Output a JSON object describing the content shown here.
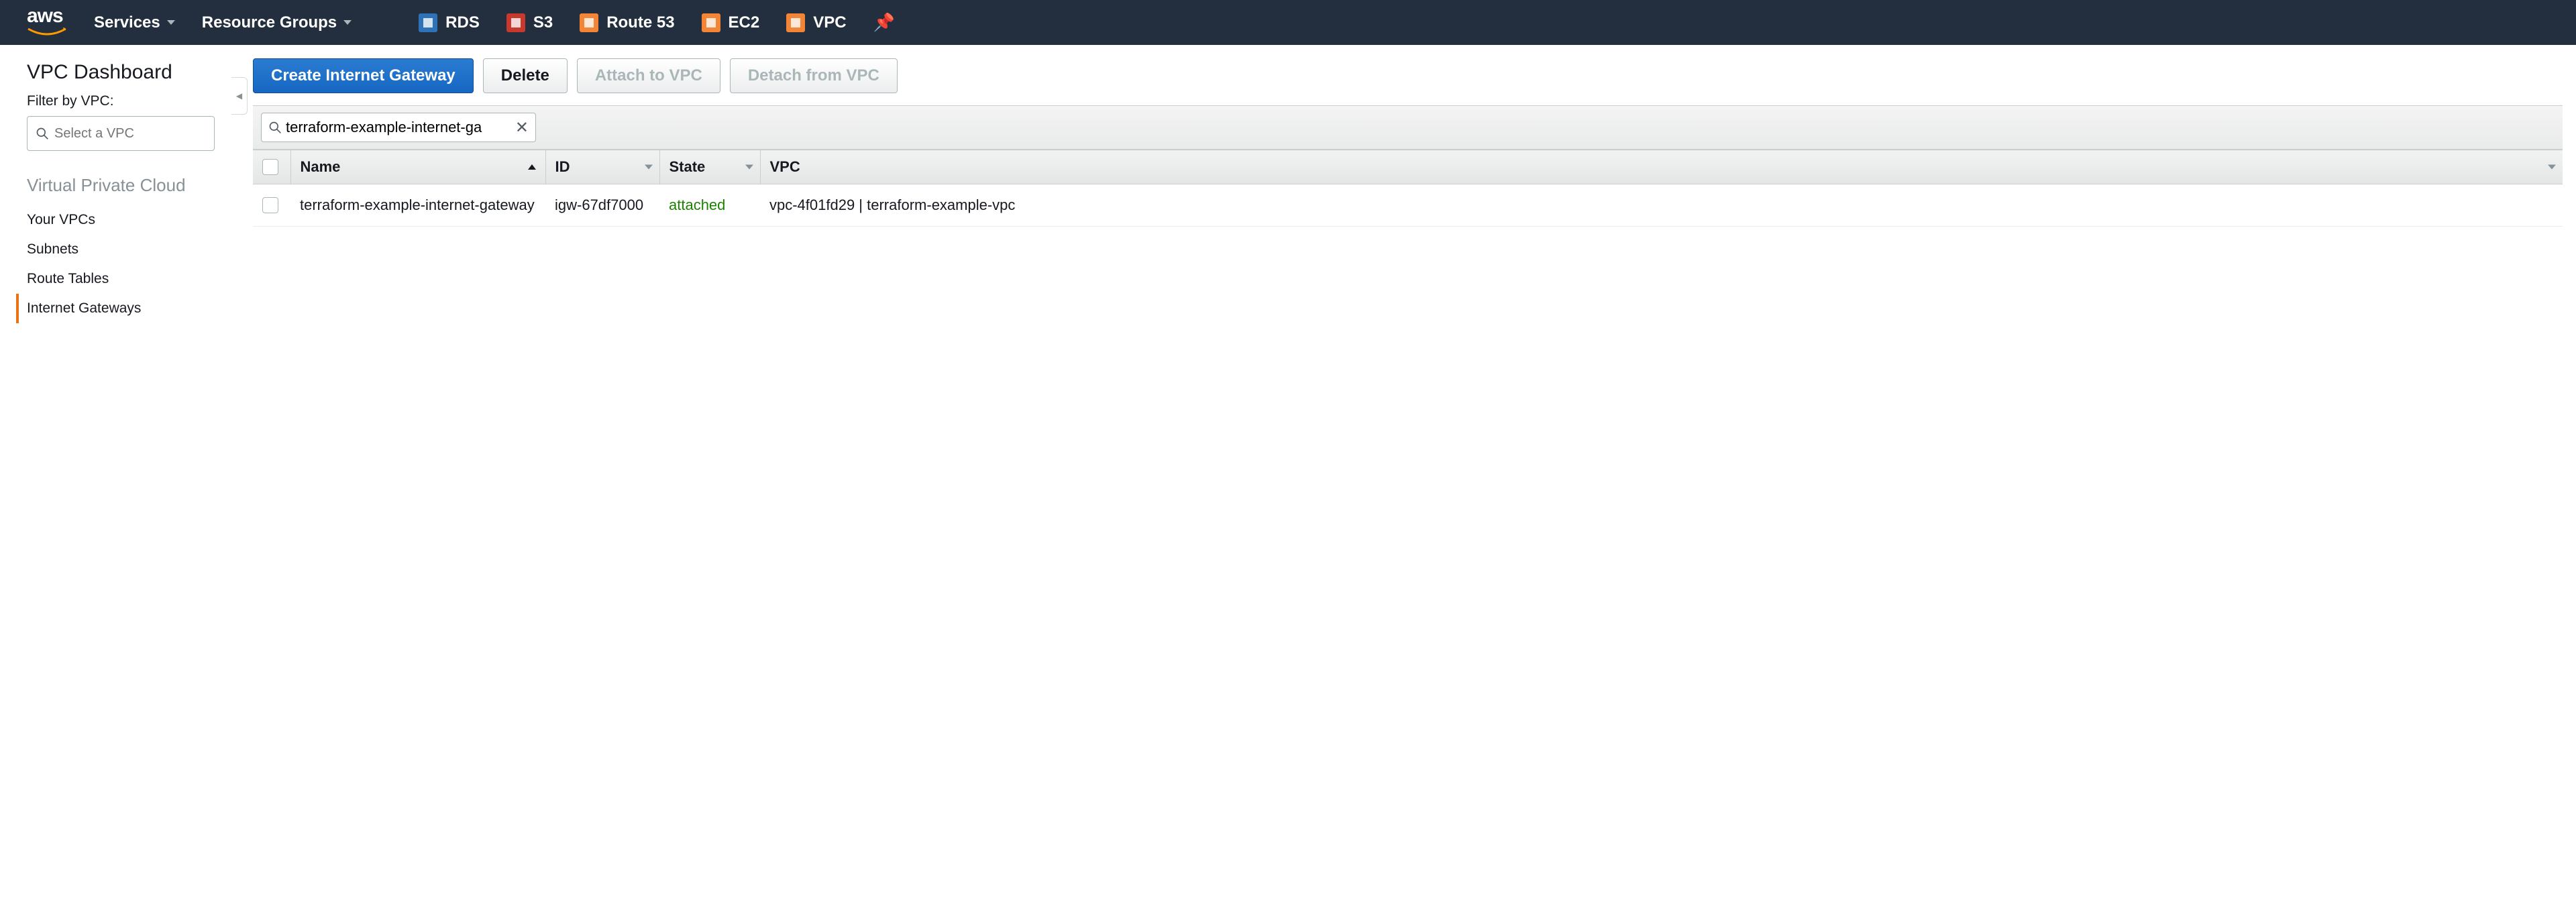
{
  "nav": {
    "services": "Services",
    "resource_groups": "Resource Groups",
    "shortcuts": [
      {
        "label": "RDS",
        "color": "blue"
      },
      {
        "label": "S3",
        "color": "red"
      },
      {
        "label": "Route 53",
        "color": "orange"
      },
      {
        "label": "EC2",
        "color": "orange"
      },
      {
        "label": "VPC",
        "color": "orange"
      }
    ]
  },
  "sidebar": {
    "title": "VPC Dashboard",
    "filter_label": "Filter by VPC:",
    "filter_placeholder": "Select a VPC",
    "section": "Virtual Private Cloud",
    "links": [
      "Your VPCs",
      "Subnets",
      "Route Tables",
      "Internet Gateways"
    ],
    "active_index": 3
  },
  "toolbar": {
    "create": "Create Internet Gateway",
    "delete": "Delete",
    "attach": "Attach to VPC",
    "detach": "Detach from VPC"
  },
  "search": {
    "value": "terraform-example-internet-ga"
  },
  "table": {
    "columns": [
      "Name",
      "ID",
      "State",
      "VPC"
    ],
    "rows": [
      {
        "name": "terraform-example-internet-gateway",
        "id": "igw-67df7000",
        "state": "attached",
        "vpc": "vpc-4f01fd29 | terraform-example-vpc"
      }
    ]
  }
}
